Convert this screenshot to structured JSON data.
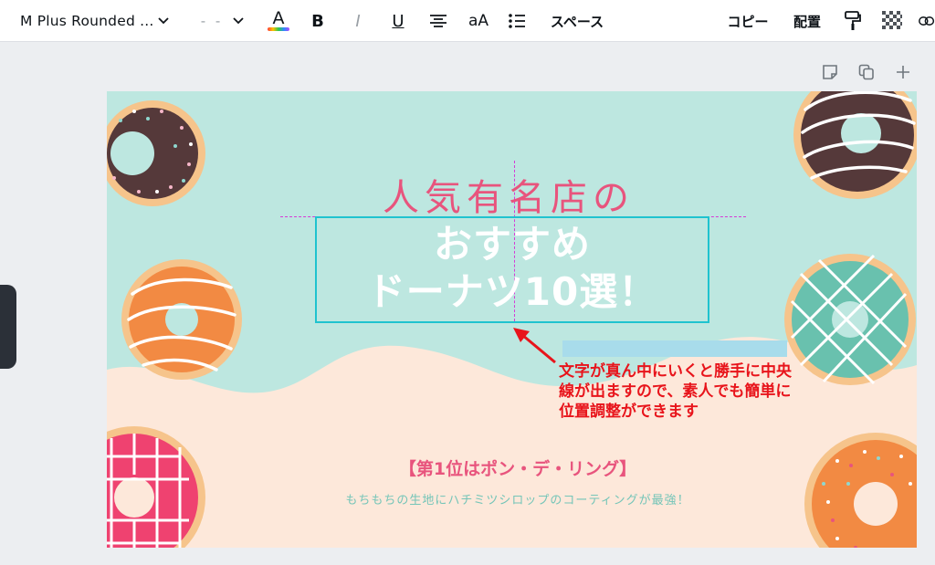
{
  "toolbar": {
    "font_name": "M Plus Rounded ...",
    "font_size": "- -",
    "text_color_letter": "A",
    "bold": "B",
    "italic": "I",
    "underline": "U",
    "case": "aA",
    "spacing": "スペース",
    "copy": "コピー",
    "position": "配置"
  },
  "canvas": {
    "title_line1": "人気有名店の",
    "title_line2a": "おすすめ",
    "title_line2b": "ドーナツ10選！",
    "rank": "【第1位はポン・デ・リング】",
    "description": "もちもちの生地にハチミツシロップのコーティングが最強！"
  },
  "annotation": {
    "text": "文字が真ん中にいくと勝手に中央\n線が出ますので、素人でも簡単に\n位置調整ができます"
  },
  "colors": {
    "canvas_bg": "#bde7e0",
    "wave": "#fde8da",
    "title_pink": "#e8547d",
    "selection": "#1fc3cf",
    "guide": "#d63bd6",
    "annotation_red": "#e8141b"
  },
  "icons": [
    "chevron-down-icon",
    "bold-icon",
    "italic-icon",
    "underline-icon",
    "align-center-icon",
    "list-icon",
    "paint-roller-icon",
    "transparency-icon",
    "link-icon",
    "note-icon",
    "duplicate-icon",
    "plus-icon"
  ]
}
